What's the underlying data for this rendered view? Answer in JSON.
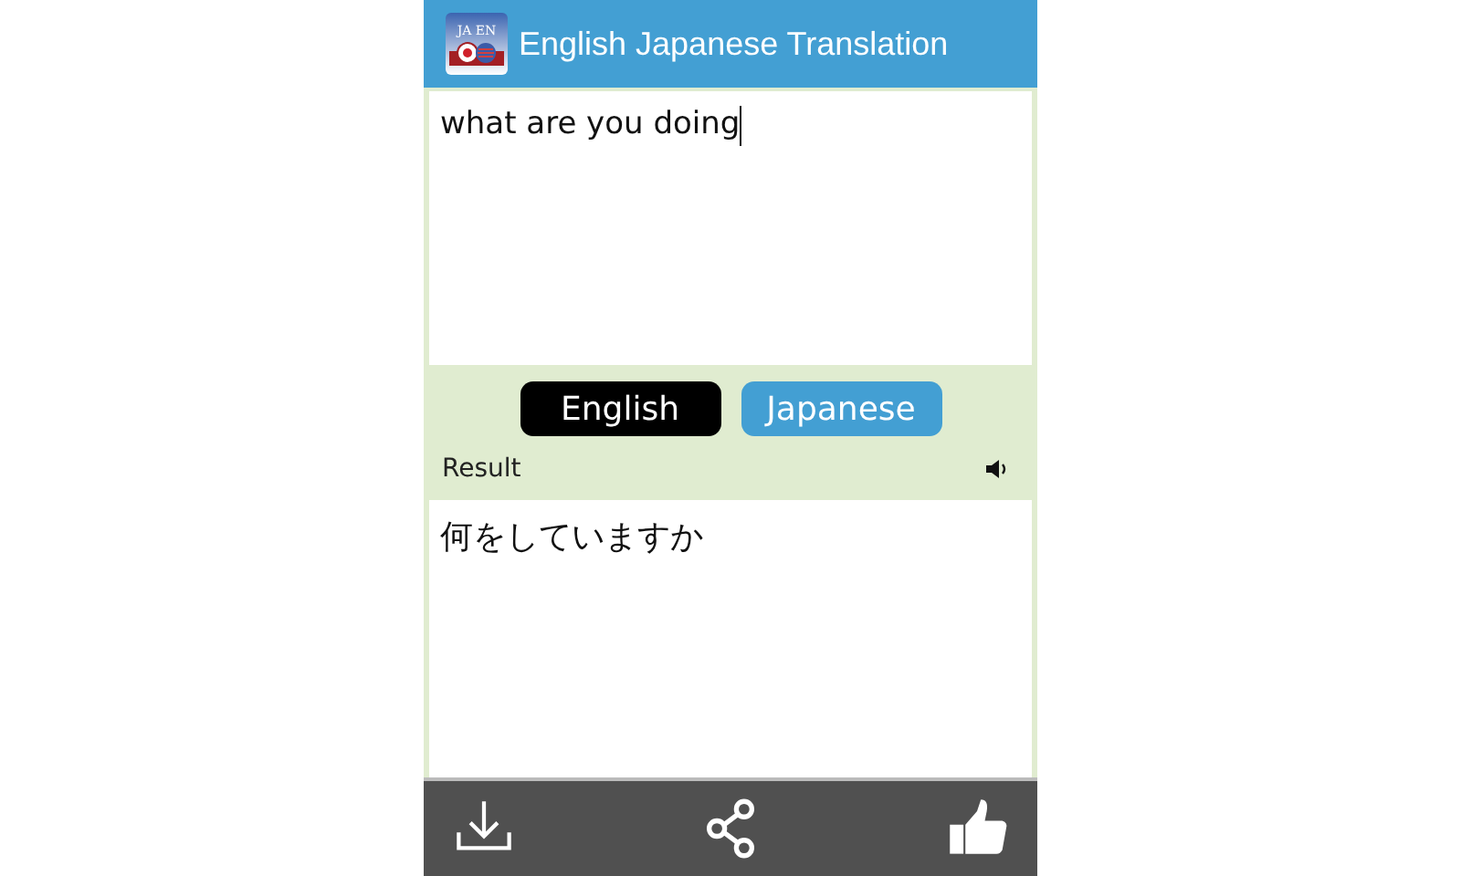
{
  "header": {
    "logo_text": "JA EN",
    "title": "English Japanese Translation"
  },
  "input": {
    "value": "what are you doing"
  },
  "languages": [
    {
      "label": "English",
      "selected": true
    },
    {
      "label": "Japanese",
      "selected": false
    }
  ],
  "result": {
    "label": "Result",
    "text": "何をしていますか"
  },
  "toolbar": [
    {
      "kind": "download"
    },
    {
      "kind": "share"
    },
    {
      "kind": "like"
    }
  ]
}
